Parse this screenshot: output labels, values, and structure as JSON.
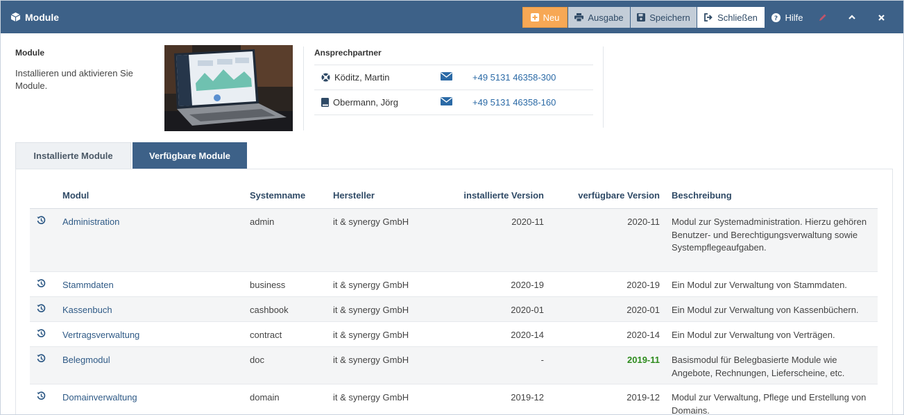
{
  "window": {
    "title": "Module",
    "colors": {
      "header": "#3d6188",
      "accent_new": "#f7a855",
      "link": "#2b6aa6",
      "green": "#2e8b1e"
    }
  },
  "toolbar": {
    "new_label": "Neu",
    "output_label": "Ausgabe",
    "save_label": "Speichern",
    "close_label": "Schließen",
    "help_label": "Hilfe"
  },
  "info": {
    "title": "Module",
    "description": "Installieren und aktivieren Sie Module."
  },
  "contacts": {
    "title": "Ansprechpartner",
    "items": [
      {
        "name": "Köditz, Martin",
        "phone": "+49 5131 46358-300",
        "icon": "lifebuoy-icon"
      },
      {
        "name": "Obermann, Jörg",
        "phone": "+49 5131 46358-160",
        "icon": "book-icon"
      }
    ]
  },
  "tabs": [
    {
      "label": "Installierte Module",
      "active": false
    },
    {
      "label": "Verfügbare Module",
      "active": true
    }
  ],
  "table": {
    "headers": [
      "Modul",
      "Systemname",
      "Hersteller",
      "installierte Version",
      "verfügbare Version",
      "Beschreibung"
    ],
    "rows": [
      {
        "modul": "Administration",
        "system": "admin",
        "hersteller": "it & synergy GmbH",
        "installed": "2020-11",
        "available": "2020-11",
        "desc": "Modul zur Systemadministration. Hierzu gehören Benutzer- und Berechtigungsverwaltung sowie Systempflegeaufgaben."
      },
      {
        "modul": "Stammdaten",
        "system": "business",
        "hersteller": "it & synergy GmbH",
        "installed": "2020-19",
        "available": "2020-19",
        "desc": "Ein Modul zur Verwaltung von Stammdaten."
      },
      {
        "modul": "Kassenbuch",
        "system": "cashbook",
        "hersteller": "it & synergy GmbH",
        "installed": "2020-01",
        "available": "2020-01",
        "desc": "Ein Modul zur Verwaltung von Kassenbüchern."
      },
      {
        "modul": "Vertragsverwaltung",
        "system": "contract",
        "hersteller": "it & synergy GmbH",
        "installed": "2020-14",
        "available": "2020-14",
        "desc": "Ein Modul zur Verwaltung von Verträgen."
      },
      {
        "modul": "Belegmodul",
        "system": "doc",
        "hersteller": "it & synergy GmbH",
        "installed": "-",
        "available": "2019-11",
        "desc": "Basismodul für Belegbasierte Module wie Angebote, Rechnungen, Lieferscheine, etc."
      },
      {
        "modul": "Domainverwaltung",
        "system": "domain",
        "hersteller": "it & synergy GmbH",
        "installed": "2019-12",
        "available": "2019-12",
        "desc": "Modul zur Verwaltung, Pflege und Erstellung von Domains."
      }
    ]
  }
}
